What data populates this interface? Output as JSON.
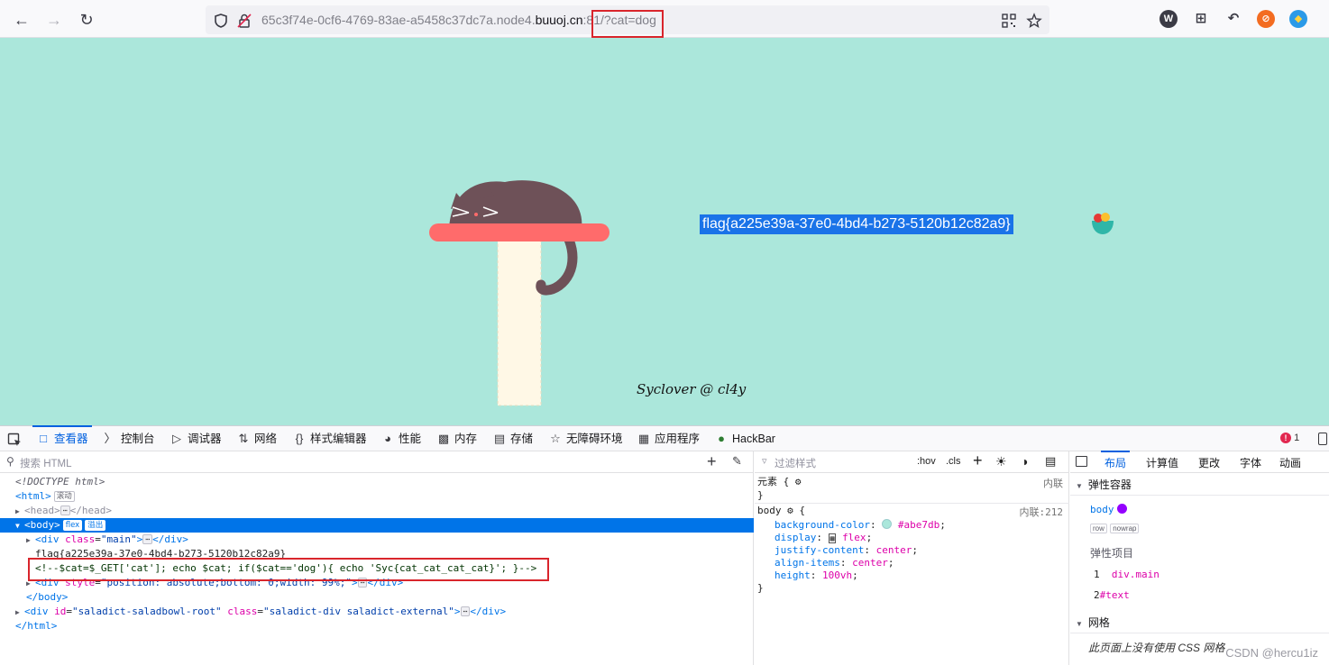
{
  "browser": {
    "url_prefix": "65c3f74e-0cf6-4769-83ae-a5458c37dc7a.node4.",
    "url_host": "buuoj.cn",
    "url_port": ":81",
    "url_query": "/?cat=dog"
  },
  "page": {
    "background": "#abe7db",
    "flag_text": "flag{a225e39a-37e0-4bd4-b273-5120b12c82a9}",
    "signature": "Syclover @ cl4y"
  },
  "devtools": {
    "tabs": [
      {
        "label": "查看器",
        "icon": "inspector-icon"
      },
      {
        "label": "控制台",
        "icon": "console-icon"
      },
      {
        "label": "调试器",
        "icon": "debugger-icon"
      },
      {
        "label": "网络",
        "icon": "network-icon"
      },
      {
        "label": "样式编辑器",
        "icon": "style-editor-icon"
      },
      {
        "label": "性能",
        "icon": "performance-icon"
      },
      {
        "label": "内存",
        "icon": "memory-icon"
      },
      {
        "label": "存储",
        "icon": "storage-icon"
      },
      {
        "label": "无障碍环境",
        "icon": "accessibility-icon"
      },
      {
        "label": "应用程序",
        "icon": "application-icon"
      },
      {
        "label": "HackBar",
        "icon": "hackbar-icon"
      }
    ],
    "error_count": "1",
    "search_placeholder": "搜索 HTML",
    "tree": {
      "doctype": "<!DOCTYPE html>",
      "html_tag": "<html>",
      "html_badge": "滚动",
      "head_open": "<head>",
      "head_close": "</head>",
      "body_tag": "<body>",
      "body_badge_flex": "flex",
      "body_badge_overflow": "溢出",
      "div_main_open": "<div ",
      "div_main_attr": "class",
      "div_main_val": "\"main\"",
      "div_close": "</div>",
      "flag_line": "flag{a225e39a-37e0-4bd4-b273-5120b12c82a9}",
      "comment": "<!--$cat=$_GET['cat']; echo $cat; if($cat=='dog'){ echo 'Syc{cat_cat_cat_cat}'; }-->",
      "div_style_attr": "style",
      "div_style_val": "\"position: absolute;bottom: 0;width: 99%;\"",
      "body_close": "</body>",
      "saladict_id": "\"saladict-saladbowl-root\"",
      "saladict_class": "\"saladict-div saladict-external\"",
      "html_close": "</html>"
    },
    "styles": {
      "filter_placeholder": "过滤样式",
      "hov": ":hov",
      "cls": ".cls",
      "element_label": "元素",
      "element_source": "内联",
      "body_selector": "body",
      "body_source": "内联:212",
      "props": [
        {
          "name": "background-color",
          "value": "#abe7db"
        },
        {
          "name": "display",
          "value": "flex"
        },
        {
          "name": "justify-content",
          "value": "center"
        },
        {
          "name": "align-items",
          "value": "center"
        },
        {
          "name": "height",
          "value": "100vh"
        }
      ]
    },
    "layout": {
      "tabs": [
        "布局",
        "计算值",
        "更改",
        "字体",
        "动画"
      ],
      "flex_container": "弹性容器",
      "flex_body": "body",
      "pill_row": "row",
      "pill_nowrap": "nowrap",
      "flex_items": "弹性项目",
      "item1_num": "1",
      "item1": "div.main",
      "item2_num": "2",
      "item2": "#text",
      "grid": "网格",
      "grid_note": "此页面上没有使用 CSS 网格"
    }
  },
  "watermark": "CSDN @hercu1iz"
}
